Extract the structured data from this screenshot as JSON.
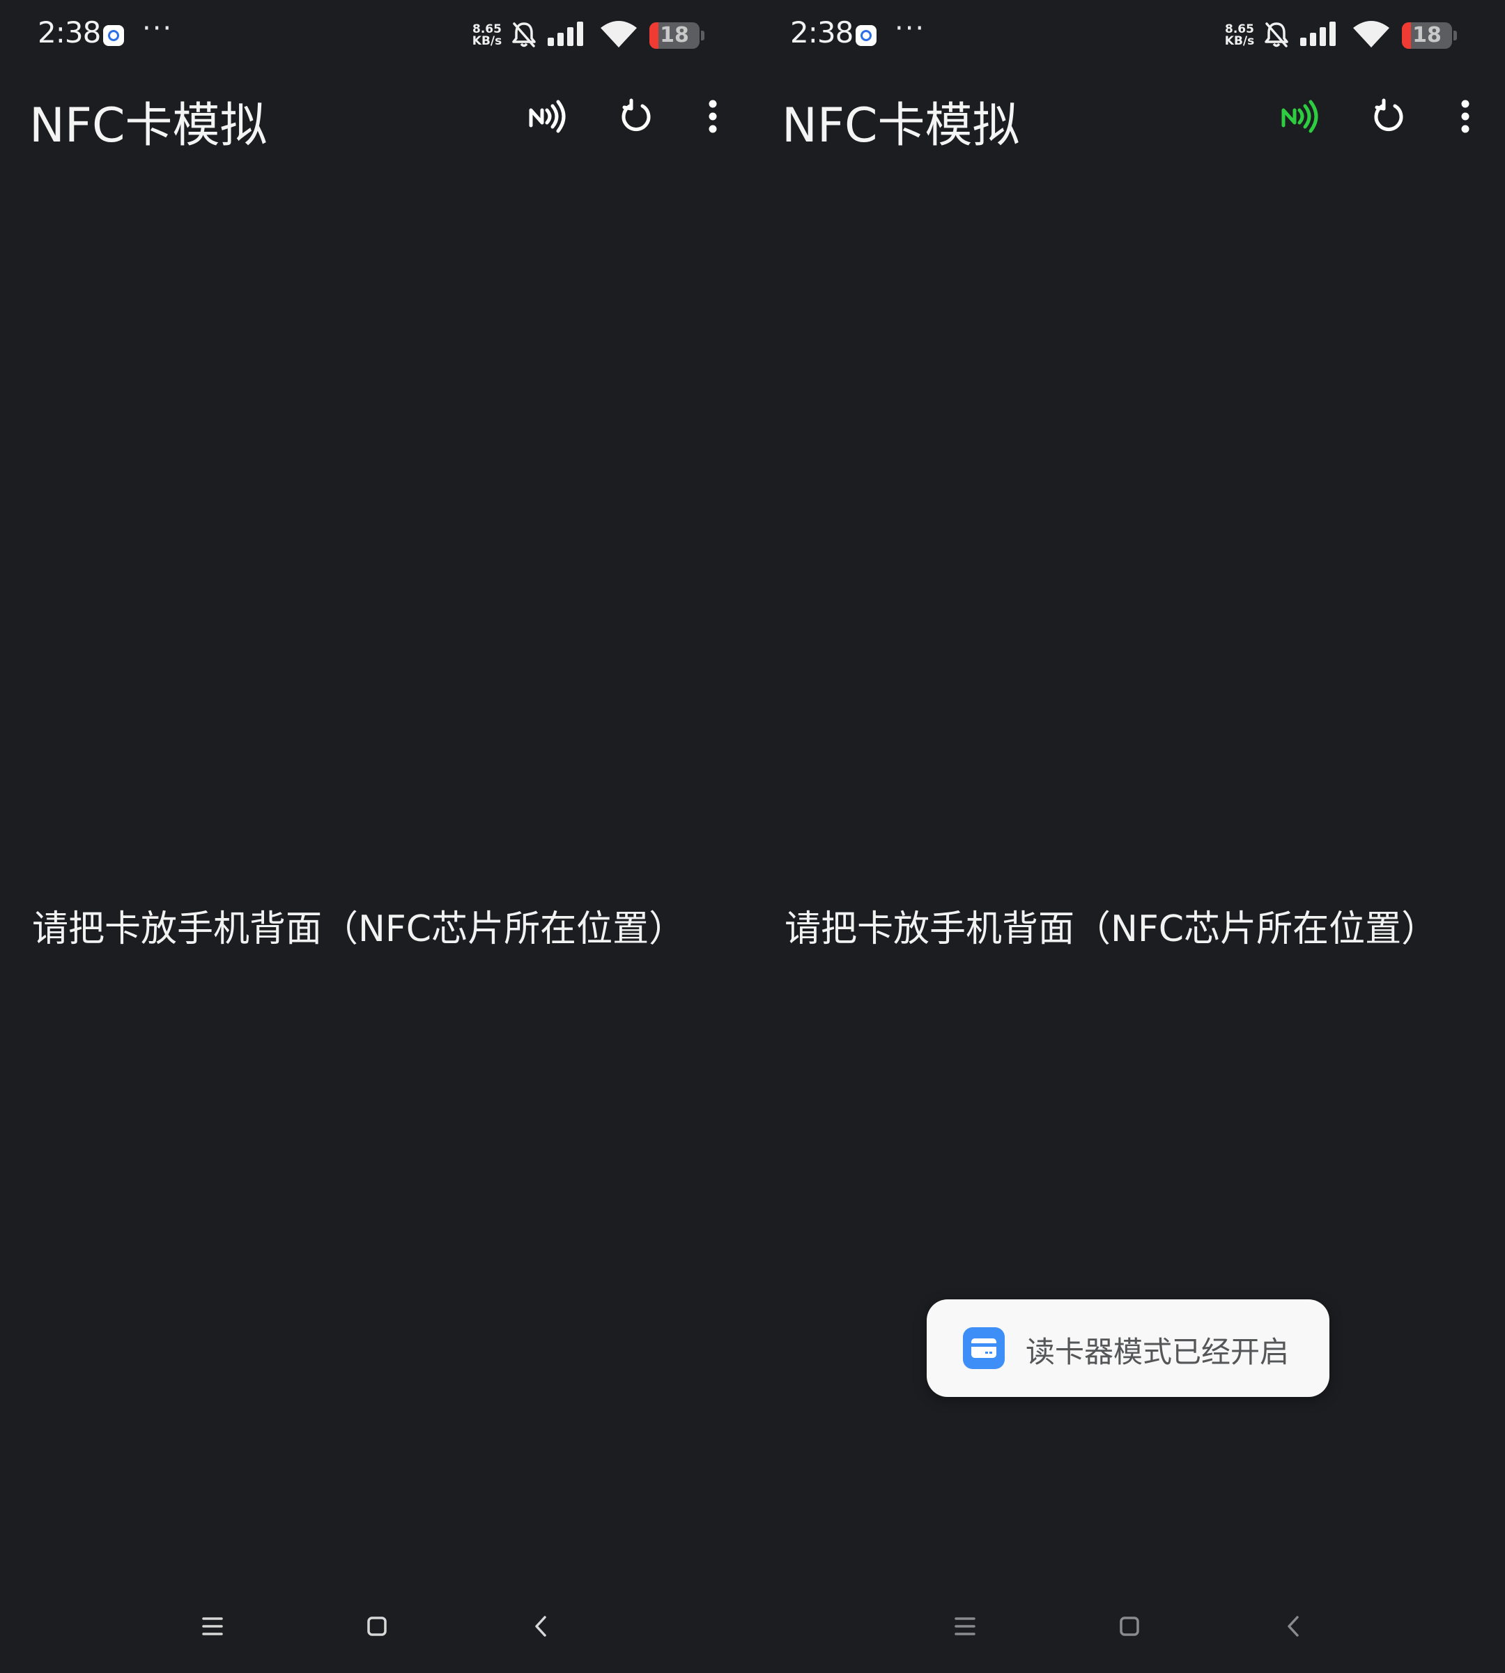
{
  "screens": [
    {
      "status_bar": {
        "time": "2:38",
        "more_indicator": "···",
        "net_speed_value": "8.65",
        "net_speed_unit": "KB/s",
        "battery_level": "18",
        "battery_fraction": 0.18,
        "icons": [
          "app-notification-icon",
          "bell-off-icon",
          "signal-icon",
          "wifi-icon",
          "battery-icon"
        ]
      },
      "app_bar": {
        "title": "NFC卡模拟",
        "nfc_icon_color": "#ffffff",
        "actions": [
          "nfc-icon",
          "refresh-icon",
          "more-vert-icon"
        ]
      },
      "main": {
        "instruction": "请把卡放手机背面（NFC芯片所在位置）"
      },
      "nav_bar": {
        "icons": [
          "menu-icon",
          "home-icon",
          "back-icon"
        ]
      }
    },
    {
      "status_bar": {
        "time": "2:38",
        "more_indicator": "···",
        "net_speed_value": "8.65",
        "net_speed_unit": "KB/s",
        "battery_level": "18",
        "battery_fraction": 0.18,
        "icons": [
          "app-notification-icon",
          "bell-off-icon",
          "signal-icon",
          "wifi-icon",
          "battery-icon"
        ]
      },
      "app_bar": {
        "title": "NFC卡模拟",
        "nfc_icon_color": "#2ecc40",
        "actions": [
          "nfc-icon",
          "refresh-icon",
          "more-vert-icon"
        ]
      },
      "main": {
        "instruction": "请把卡放手机背面（NFC芯片所在位置）"
      },
      "toast": {
        "icon": "card-reader-icon",
        "icon_color": "#3d8ef7",
        "text": "读卡器模式已经开启"
      },
      "nav_bar": {
        "icons": [
          "menu-icon",
          "home-icon",
          "back-icon"
        ]
      }
    }
  ],
  "colors": {
    "background": "#1c1d20",
    "text": "#f2f2f2",
    "battery_low": "#f03b32",
    "toast_background": "#f8f8f8"
  }
}
